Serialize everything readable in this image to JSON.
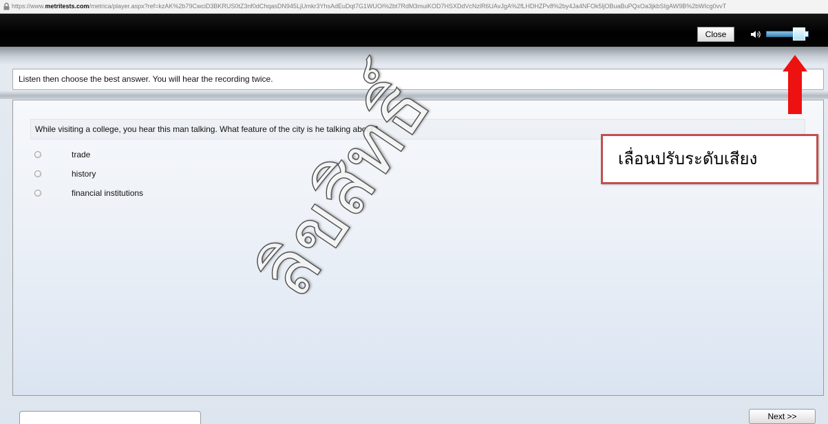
{
  "browser": {
    "lock_icon": "lock-icon",
    "url_prefix": "https://www.",
    "url_domain": "metritests.com",
    "url_path": "/metrica/player.aspx?ref=kzAK%2b79CwciD3BKRUS0tZ3nf0dChqasDN945LjUmkr3YhsAdEuDqt7G1WUOi%2bt7RdM3muiKOD7HSXDdVcNzlR6UAvJgA%2fLHDHZPv8%2by4Ja4NFOk5ljOBuaBuPQxOa3jkbSIgAW9B%2bWIcg0vvT"
  },
  "toolbar": {
    "close_label": "Close",
    "volume_icon": "speaker-icon",
    "volume_level": 0.9
  },
  "instruction": "Listen then choose the best answer. You will hear the recording twice.",
  "question": {
    "prompt": "While visiting a college, you hear this man talking. What feature of the city is he talking about?",
    "options": [
      {
        "label": "trade",
        "selected": false
      },
      {
        "label": "history",
        "selected": false
      },
      {
        "label": "financial institutions",
        "selected": false
      }
    ]
  },
  "annotation": {
    "arrow_icon": "arrow-up-icon",
    "text": "เลื่อนปรับระดับเสียง"
  },
  "watermark": {
    "text": "ลิขสิทธิ์"
  },
  "footer": {
    "next_label": "Next >>"
  },
  "colors": {
    "topbar": "#000000",
    "arrow_red": "#ee1111",
    "annotation_border": "#c0504d",
    "slider_blue": "#3f88bb",
    "slider_thumb": "#aee0f7"
  }
}
